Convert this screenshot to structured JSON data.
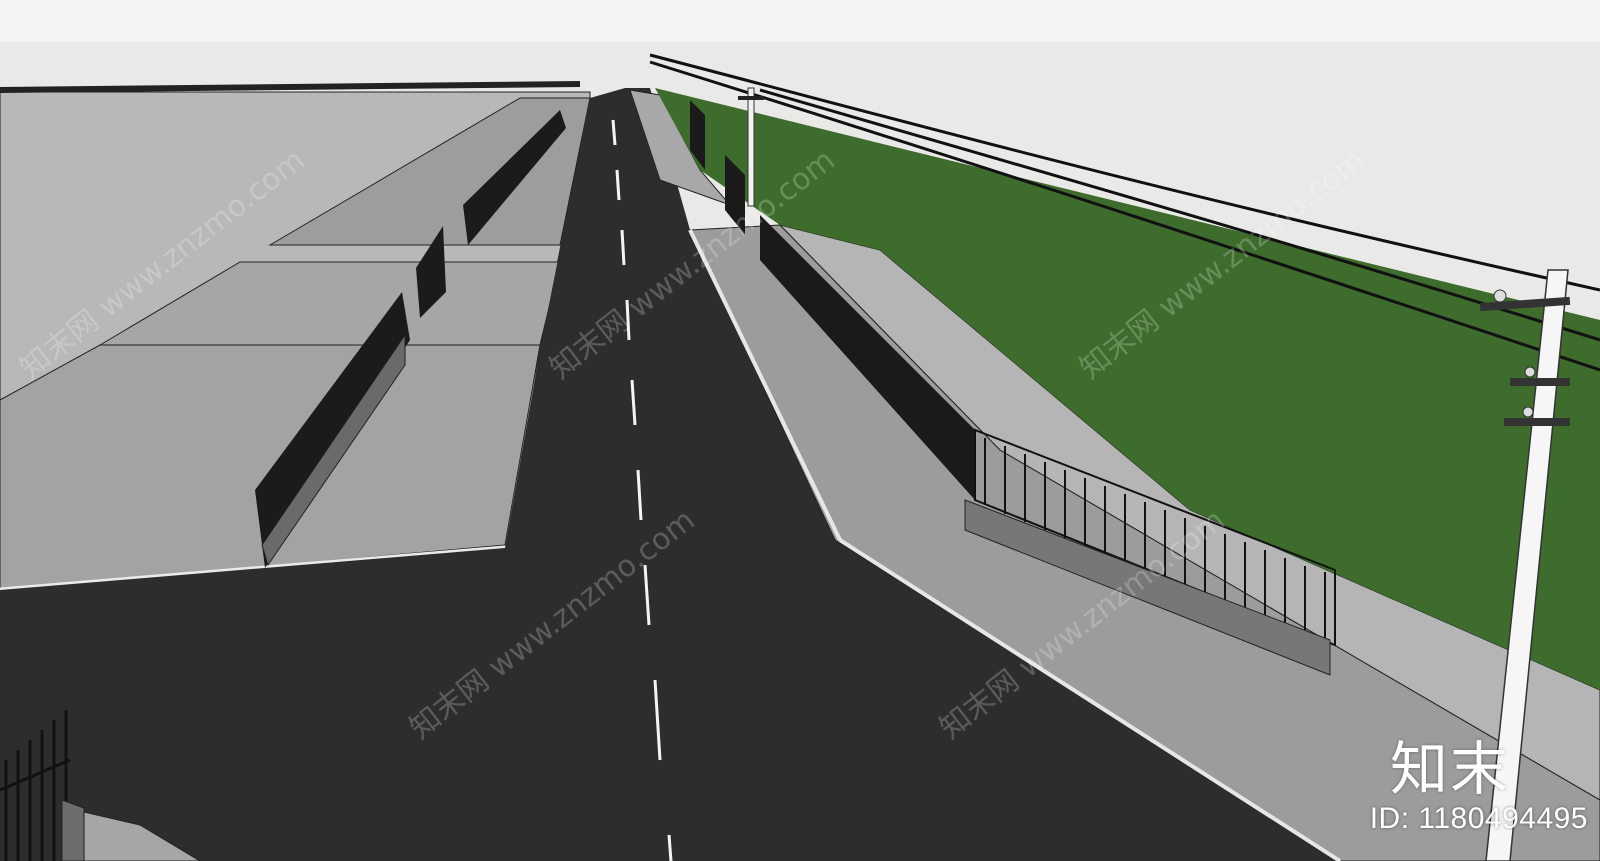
{
  "watermark": {
    "text": "知末网 www.znzmo.com",
    "brand": "知末",
    "asset_id": "ID: 1180494495"
  },
  "scene": {
    "description_colors": {
      "sky": "#e9e9e7",
      "asphalt": "#2d2d2f",
      "grass": "#3e6c2c",
      "pavement": "#a9a9a9",
      "kerb": "#d9d9d9",
      "wall": "#707070",
      "fence": "#1a1a1a",
      "pole": "#f2f2f2"
    }
  }
}
